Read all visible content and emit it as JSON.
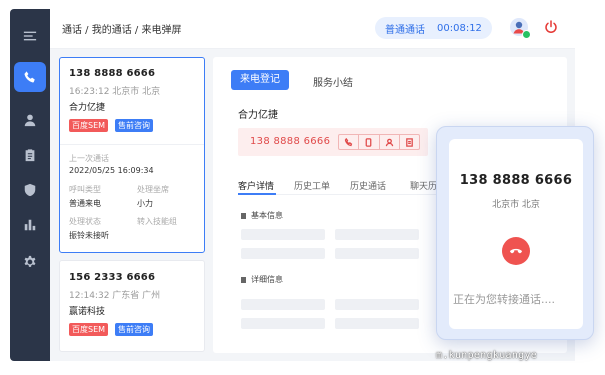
{
  "breadcrumb": "通话 / 我的通话 / 来电弹屏",
  "call_status": {
    "label": "普通通话",
    "timer": "00:08:12"
  },
  "calls": [
    {
      "phone": "138 8888 6666",
      "time_location": "16:23:12  北京市 北京",
      "company": "合力亿捷",
      "tags": [
        "百度SEM",
        "售前咨询"
      ],
      "last_call_label": "上一次通话",
      "last_call_time": "2022/05/25  16:09:34",
      "call_type_label": "呼叫类型",
      "call_type_value": "普通来电",
      "agent_label": "处理坐席",
      "agent_value": "小力",
      "status_label": "处理状态",
      "status_value": "振铃未接听",
      "transfer_label": "转入技能组"
    },
    {
      "phone": "156 2333 6666",
      "time_location": "12:14:32  广东省 广州",
      "company": "赢诺科技",
      "tags": [
        "百度SEM",
        "售前咨询"
      ]
    }
  ],
  "detail": {
    "tabs": [
      "来电登记",
      "服务小结"
    ],
    "company": "合力亿捷",
    "phone": "138 8888 6666",
    "subtabs": [
      "客户详情",
      "历史工单",
      "历史通话",
      "聊天历"
    ],
    "sections": [
      "基本信息",
      "详细信息"
    ]
  },
  "incoming_popup": {
    "phone": "138 8888 6666",
    "location": "北京市 北京",
    "status": "正在为您转接通话...."
  },
  "watermark": "m.kunpengkuangye",
  "colors": {
    "primary": "#3d7df6",
    "sidebar": "#2b3548",
    "danger": "#ef5350",
    "tag_red": "#f25a5a"
  }
}
